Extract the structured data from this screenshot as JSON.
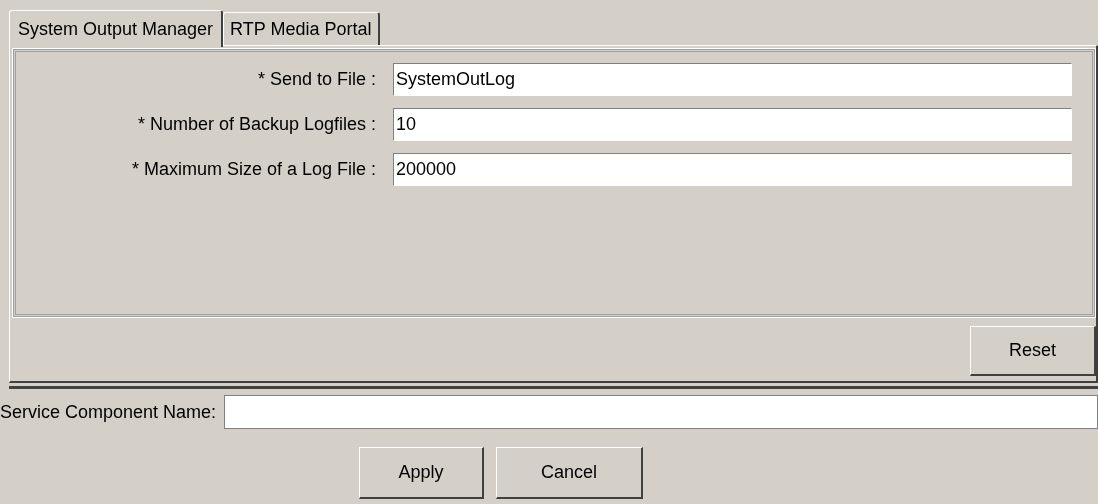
{
  "tabs": [
    {
      "label": "System Output Manager",
      "selected": true
    },
    {
      "label": "RTP Media Portal",
      "selected": false
    }
  ],
  "fields": [
    {
      "label": "* Send to File :",
      "value": "SystemOutLog"
    },
    {
      "label": "* Number of Backup Logfiles :",
      "value": "10"
    },
    {
      "label": "* Maximum Size of a Log File :",
      "value": "200000"
    }
  ],
  "reset_button": "Reset",
  "service_component": {
    "label": "Service Component Name:"
  },
  "buttons": [
    "Apply",
    "Cancel"
  ]
}
